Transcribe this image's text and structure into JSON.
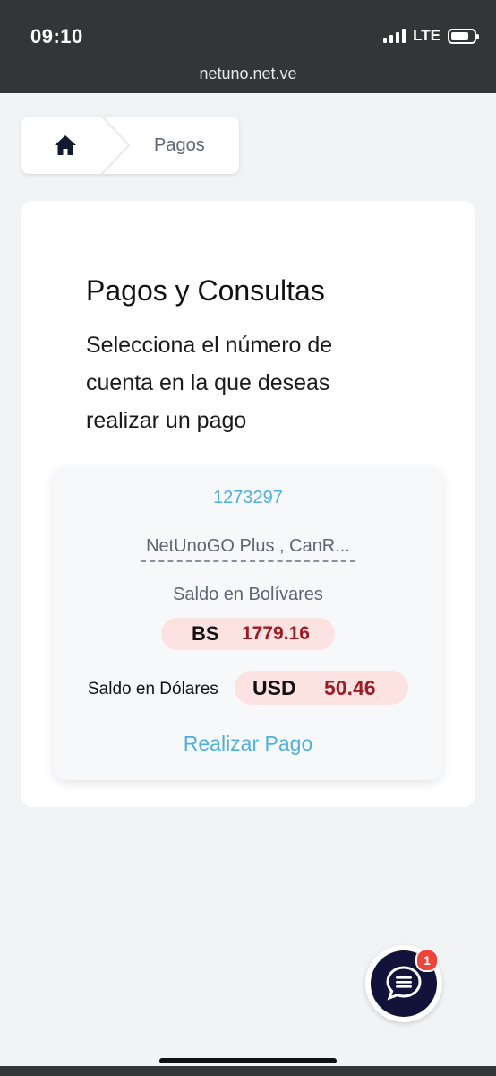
{
  "status_bar": {
    "time": "09:10",
    "network": "LTE",
    "url": "netuno.net.ve"
  },
  "breadcrumb": {
    "home_icon": "home-icon",
    "current": "Pagos"
  },
  "page": {
    "title": "Pagos y Consultas",
    "subtitle": "Selecciona el número de cuenta en la que deseas realizar un pago"
  },
  "account": {
    "number": "1273297",
    "plan": "NetUnoGO Plus , CanR...",
    "bs_label": "Saldo en Bolívares",
    "bs_currency": "BS",
    "bs_amount": "1779.16",
    "usd_label": "Saldo en Dólares",
    "usd_currency": "USD",
    "usd_amount": "50.46",
    "pay_label": "Realizar Pago"
  },
  "chat": {
    "icon": "chat-icon",
    "badge": "1"
  },
  "colors": {
    "accent": "#4fb1d9",
    "amount": "#9b1c24",
    "pill": "#fde2e2",
    "chat_bg": "#12123a",
    "badge": "#f0443a"
  }
}
